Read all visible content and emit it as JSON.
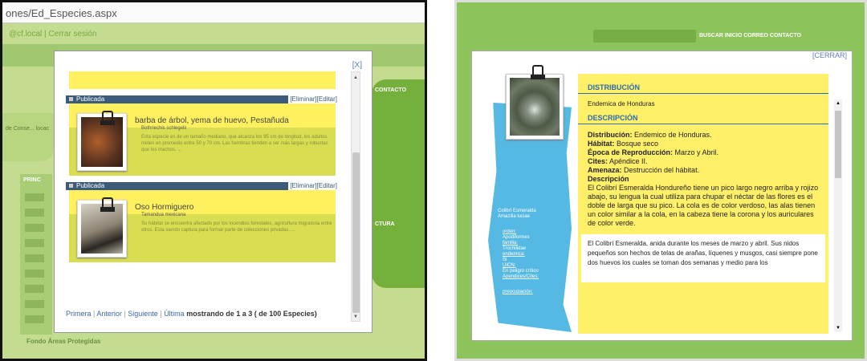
{
  "left": {
    "address": "ones/Ed_Especies.aspx",
    "session": "@cf.local | Cerrar sesión",
    "bg_tab_text": "de Conse... locac",
    "bg_nav_top": "PRINC",
    "bg_right_items": [
      "CONTACTO",
      "CTURA"
    ],
    "bg_bottom": "Fondo Áreas Protegidas",
    "close_label": "[X]",
    "records": [
      {
        "status": "Publicada",
        "actions": "[Eliminar][Editar]",
        "name": "barba de árbol, yema de huevo, Pestañuda",
        "sci": "Bothriechis schlegelii",
        "desc": "Esta especie es de un tamaño mediano, que alcanza los 95 cm de longitud, los adultos miden en promedio entre 50 y 70 cm. Las hembras tienden a ser más largas y robustas que los machos. ..."
      },
      {
        "status": "Publicada",
        "actions": "[Eliminar][Editar]",
        "name": "Oso Hormiguero",
        "sci": "Tamandua mexicana",
        "desc": "Su hábitat se encuentra afectado por los incendios forestales, agricultura migratoria entre otros. Esta siendo captura para formar parte de colecciones privadas. ..."
      }
    ],
    "pager": {
      "first": "Primera",
      "prev": "Anterior",
      "next": "Siguiente",
      "last": "Última",
      "summary": "mostrando de 1 a 3 ( de 100 Especies)"
    }
  },
  "right": {
    "nav": "BUSCAR   INICIO   CORREO   CONTACTO",
    "close_label": "[CERRAR]",
    "common": "Colibrí Esmeralda",
    "sci": "Amazilia luciae",
    "orden_label": "orden:",
    "orden": "Apodiformes",
    "familia_label": "familia:",
    "familia": "Trochilidae",
    "endemica_label": "endemica:",
    "endemica": "Si",
    "uicn_label": "UICN:",
    "uicn": "En peligro crítico",
    "apendices_label": "Apendices/Cites:",
    "preocupacion_label": "preocupación:",
    "distribucion_h": "DISTRIBUCIÓN",
    "distribucion": "Endemica de Honduras",
    "descripcion_h": "DESCRIPCIÓN",
    "d_dist_k": "Distribución:",
    "d_dist_v": " Endemico de Honduras.",
    "d_hab_k": "Hábitat:",
    "d_hab_v": " Bosque seco",
    "d_rep_k": "Época de Reproducción:",
    "d_rep_v": " Marzo y Abril.",
    "d_cites_k": "Cites:",
    "d_cites_v": " Apéndice II.",
    "d_amen_k": "Amenaza:",
    "d_amen_v": " Destrucción del hábitat.",
    "d_desc_k": "Descripción",
    "d_desc_v": "El Colibrí Esmeralda Hondureño tiene un pico largo negro arriba y rojizo abajo, su lengua la cual utiliza para chupar el néctar de las flores es el doble de larga que su pico. La cola es de color verdoso, las alas tienen un color similar a la cola, en la cabeza tiene la corona y los auriculares de color verde.",
    "extra": "El Colibrí Esmeralda, anida durante los meses de marzo y abril. Sus nidos pequeños son hechos de telas de arañas, líquenes y musgos, casi siempre pone dos huevos los cuales se toman dos semanas y medio para los"
  }
}
